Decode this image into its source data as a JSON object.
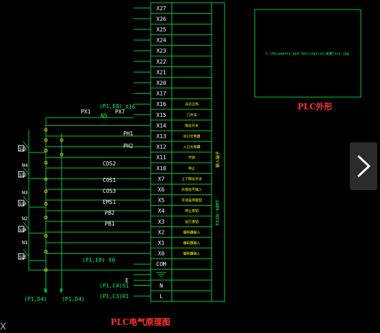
{
  "colors": {
    "line": "#00cc44",
    "text_white": "#ffffff",
    "text_green": "#00ff66",
    "text_yellow": "#ffff00",
    "title_red": "#ff3333",
    "background": "#000000"
  },
  "terminals": [
    "X27",
    "X26",
    "X25",
    "X24",
    "X23",
    "X22",
    "X21",
    "X20",
    "X17",
    "X16",
    "X15",
    "X14",
    "X13",
    "X12",
    "X11",
    "X10",
    "X7",
    "X6",
    "X5",
    "X4",
    "X3",
    "X2",
    "X1",
    "X0",
    "COM",
    "",
    "N",
    "L"
  ],
  "terminal_descriptions": {
    "X16": "马达过热",
    "X15": "门开关",
    "X14": "限位开关",
    "X13": "出口光电器",
    "X12": "入口光电器",
    "X11": "开启",
    "X10": "停止",
    "X7": "上下限位开关",
    "X6": "外部信号输入",
    "X5": "手动急停按钮",
    "X4": "停止按钮",
    "X3": "运行按钮",
    "X2": "编码器输入",
    "X1": "编码器输入",
    "X0": "编码器输入"
  },
  "plc_model": "FX1N-40MT",
  "plc_side_label": "输入端子",
  "components": {
    "px1": "PX1",
    "px7": "PX7",
    "n5": "N5",
    "ref_p1e8_top": "(P1,E8)",
    "x16_ref": "X16",
    "ph1": "PH1",
    "ph2": "PH2",
    "cds2": "CDS2",
    "cos1": "COS1",
    "cos3": "COS3",
    "ems1": "EMS1",
    "pb2": "PB2",
    "pb1": "PB1",
    "ref_p1e8_x0": "(P1,E8) X0",
    "sq_labels": [
      "SQ1",
      "SQ2",
      "SQ3",
      "SQ4",
      "SQ5"
    ],
    "n_labels": [
      "N4",
      "N3",
      "N2",
      "N1"
    ],
    "bottom_n": "N",
    "bottom_p": "P",
    "ref_p1d4_left": "(P1,D4)",
    "ref_p1d4_right": "(P1,D4)",
    "ref_p1c4": "(P1,C4)S1",
    "ref_p1c3": "(P1,C3)R1",
    "e_label": "E"
  },
  "image_box": {
    "path": "C:\\Documents and Settings\\ss\\桌面\\sss.jpg"
  },
  "titles": {
    "plc_outline": "PLC外形",
    "plc_schematic": "PLC电气原理图"
  },
  "nav": {
    "next_icon": "chevron-right-icon"
  }
}
